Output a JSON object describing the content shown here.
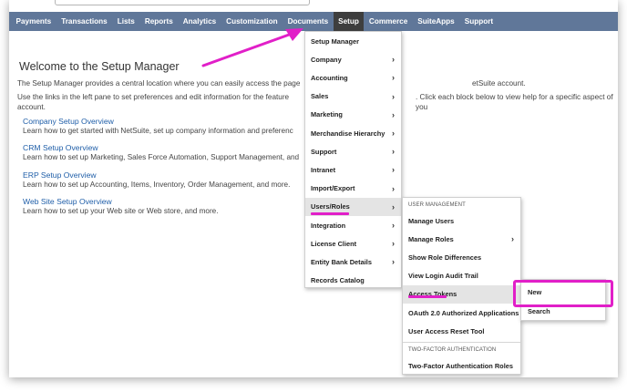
{
  "top": {
    "corner_text": ""
  },
  "nav": [
    "Payments",
    "Transactions",
    "Lists",
    "Reports",
    "Analytics",
    "Customization",
    "Documents",
    "Setup",
    "Commerce",
    "SuiteApps",
    "Support"
  ],
  "content": {
    "title": "Welcome to the Setup Manager",
    "intro1": "The Setup Manager provides a central location where you can easily access the page",
    "intro1_tail": "etSuite account.",
    "intro2": "Use the links in the left pane to set preferences and edit information for the feature",
    "intro2_tail": ". Click each block below to view help for a specific aspect of you",
    "intro3": "account.",
    "sections": [
      {
        "link": "Company Setup Overview",
        "desc": "Learn how to get started with NetSuite, set up company information and preferenc"
      },
      {
        "link": "CRM Setup Overview",
        "desc": "Learn how to set up Marketing, Sales Force Automation, Support Management, and"
      },
      {
        "link": "ERP Setup Overview",
        "desc": "Learn how to set up Accounting, Items, Inventory, Order Management, and more."
      },
      {
        "link": "Web Site Setup Overview",
        "desc": "Learn how to set up your Web site or Web store, and more."
      }
    ]
  },
  "setup_menu": {
    "items": [
      {
        "label": "Setup Manager",
        "sub": false
      },
      {
        "label": "Company",
        "sub": true
      },
      {
        "label": "Accounting",
        "sub": true
      },
      {
        "label": "Sales",
        "sub": true
      },
      {
        "label": "Marketing",
        "sub": true
      },
      {
        "label": "Merchandise Hierarchy",
        "sub": true
      },
      {
        "label": "Support",
        "sub": true
      },
      {
        "label": "Intranet",
        "sub": true
      },
      {
        "label": "Import/Export",
        "sub": true
      },
      {
        "label": "Users/Roles",
        "sub": true
      },
      {
        "label": "Integration",
        "sub": true
      },
      {
        "label": "License Client",
        "sub": true
      },
      {
        "label": "Entity Bank Details",
        "sub": true
      },
      {
        "label": "Records Catalog",
        "sub": false
      }
    ],
    "chevron": "›"
  },
  "users_menu": {
    "section1": "USER MANAGEMENT",
    "items1": [
      {
        "label": "Manage Users",
        "sub": false
      },
      {
        "label": "Manage Roles",
        "sub": true
      },
      {
        "label": "Show Role Differences",
        "sub": false
      },
      {
        "label": "View Login Audit Trail",
        "sub": false
      },
      {
        "label": "Access Tokens",
        "sub": false
      },
      {
        "label": "OAuth 2.0 Authorized Applications",
        "sub": false
      },
      {
        "label": "User Access Reset Tool",
        "sub": false
      }
    ],
    "section2": "TWO-FACTOR AUTHENTICATION",
    "items2": [
      {
        "label": "Two-Factor Authentication Roles",
        "sub": false
      }
    ]
  },
  "tokens_menu": {
    "items": [
      "New",
      "Search"
    ]
  },
  "colors": {
    "nav_bg": "#607799",
    "nav_active": "#3e3e3e",
    "link": "#1f5ea8",
    "annotation": "#e11fc8"
  }
}
